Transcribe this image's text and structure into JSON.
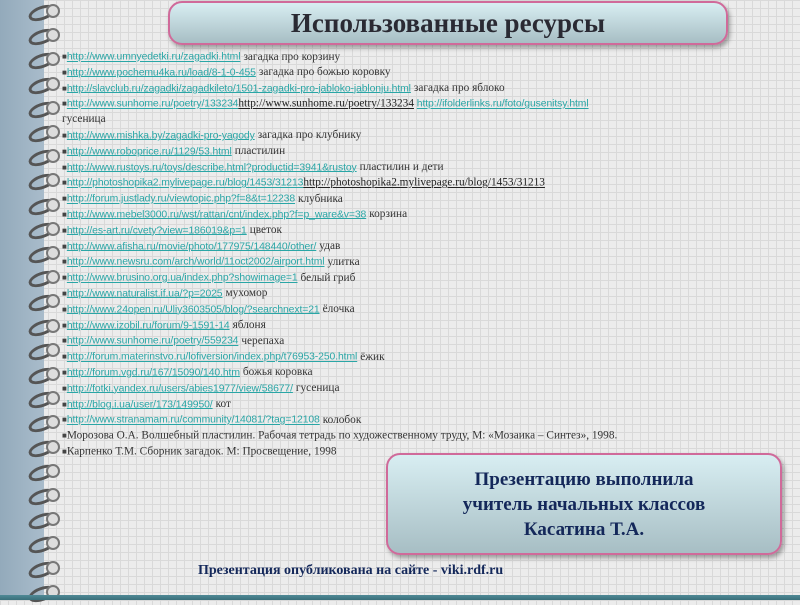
{
  "title": "Использованные ресурсы",
  "items": [
    {
      "url": "http://www.umnyedetki.ru/zagadki.html",
      "text": "загадка про корзину"
    },
    {
      "url": "http://www.pochemu4ka.ru/load/8-1-0-455",
      "text": "загадка про божью коровку"
    },
    {
      "url": "http://slavclub.ru/zagadki/zagadkileto/1501-zagadki-pro-jabloko-jablonju.html",
      "text": "загадка про  яблоко"
    },
    {
      "url": "http://www.sunhome.ru/poetry/133234",
      "plain": "http://www.sunhome.ru/poetry/133234",
      "url2": "http://ifolderlinks.ru/foto/gusenitsy.html"
    },
    {
      "cont": "гусеница"
    },
    {
      "url": "http://www.mishka.by/zagadki-pro-yagody",
      "text": "загадка про клубнику"
    },
    {
      "url": "http://www.roboprice.ru/1129/53.html",
      "text": "пластилин"
    },
    {
      "url": "http://www.rustoys.ru/toys/describe.html?productid=3941&rustoy",
      "text": "пластилин и дети"
    },
    {
      "url": "http://photoshopika2.mylivepage.ru/blog/1453/31213",
      "plain": "http://photoshopika2.mylivepage.ru/blog/1453/31213"
    },
    {
      "url": "http://forum.justlady.ru/viewtopic.php?f=8&t=12238",
      "text": "клубника"
    },
    {
      "url": "http://www.mebel3000.ru/wst/rattan/cnt/index.php?f=p_ware&v=38",
      "text": "корзина"
    },
    {
      "url": "http://es-art.ru/cvety?view=186019&p=1",
      "text": "цветок"
    },
    {
      "url": "http://www.afisha.ru/movie/photo/177975/148440/other/",
      "text": "удав"
    },
    {
      "url": "http://www.newsru.com/arch/world/11oct2002/airport.html",
      "text": "улитка"
    },
    {
      "url": "http://www.brusino.org.ua/index.php?showimage=1",
      "text": "белый гриб"
    },
    {
      "url": "http://www.naturalist.if.ua/?p=2025",
      "text": "мухомор"
    },
    {
      "url": "http://www.24open.ru/Uliy3603505/blog/?searchnext=21",
      "text": "ёлочка"
    },
    {
      "url": "http://www.izobil.ru/forum/9-1591-14",
      "text": "яблоня"
    },
    {
      "url": "http://www.sunhome.ru/poetry/559234",
      "text": "черепаха"
    },
    {
      "url": "http://forum.materinstvo.ru/lofiversion/index.php/t76953-250.html",
      "text": "ёжик"
    },
    {
      "url": "http://forum.vgd.ru/167/15090/140.htm",
      "text": "божья коровка"
    },
    {
      "url": "http://fotki.yandex.ru/users/abies1977/view/58677/",
      "text": "гусеница"
    },
    {
      "url": "http://blog.i.ua/user/173/149950/",
      "text": "кот"
    },
    {
      "url": "http://www.stranamam.ru/community/14081/?tag=12108",
      "text": "колобок"
    },
    {
      "ref": "Морозова О.А.  Волшебный пластилин. Рабочая тетрадь по художественному труду, М: «Мозаика – Синтез», 1998."
    },
    {
      "ref": "Карпенко Т.М. Сборник загадок. М: Просвещение, 1998"
    }
  ],
  "author": {
    "line1": "Презентацию выполнила",
    "line2": "учитель начальных классов",
    "line3": "Касатина Т.А."
  },
  "footer": "Презентация опубликована на сайте - viki.rdf.ru"
}
